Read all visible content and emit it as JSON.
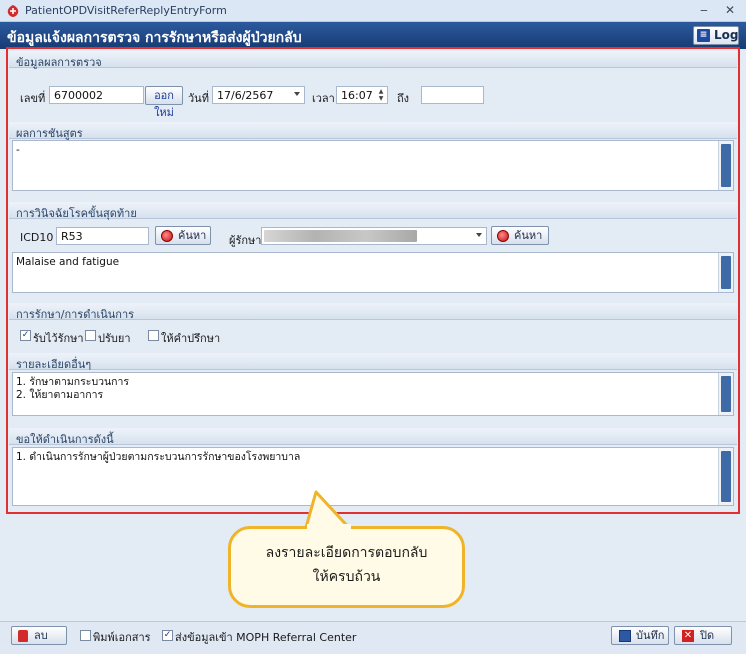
{
  "window": {
    "title": "PatientOPDVisitReferReplyEntryForm",
    "minimize": "‒",
    "close": "✕"
  },
  "header": {
    "title": "ข้อมูลแจ้งผลการตรวจ การรักษาหรือส่งผู้ป่วยกลับ",
    "log_label": "Log"
  },
  "exam": {
    "section": "ข้อมูลผลการตรวจ",
    "number_label": "เลขที่",
    "number_value": "6700002",
    "new_button": "ออกใหม่",
    "date_label": "วันที่",
    "date_value": "17/6/2567",
    "time_label": "เวลา",
    "time_value": "16:07",
    "to_label": "ถึง",
    "to_value": ""
  },
  "lab": {
    "section": "ผลการชันสูตร",
    "lines": [
      "-"
    ]
  },
  "diagnosis": {
    "section": "การวินิจฉัยโรคขั้นสุดท้าย",
    "icd_label": "ICD10",
    "icd_value": "R53",
    "search_label": "ค้นหา",
    "doctor_label": "ผู้รักษา",
    "lines": [
      "Malaise and fatigue"
    ]
  },
  "treatment": {
    "section": "การรักษา/การดำเนินการ",
    "options": [
      {
        "label": "รับไว้รักษา",
        "checked": true
      },
      {
        "label": "ปรับยา",
        "checked": false
      },
      {
        "label": "ให้คำปรึกษา",
        "checked": false
      }
    ]
  },
  "details": {
    "section": "รายละเอียดอื่นๆ",
    "lines": [
      "1. รักษาตามกระบวนการ",
      "2. ให้ยาตามอาการ"
    ]
  },
  "request": {
    "section": "ขอให้ดำเนินการดังนี้",
    "lines": [
      "1. ดำเนินการรักษาผู้ป่วยตามกระบวนการรักษาของโรงพยาบาล"
    ]
  },
  "callout": {
    "line1": "ลงรายละเอียดการตอบกลับ",
    "line2": "ให้ครบถ้วน"
  },
  "footer": {
    "delete_label": "ลบ",
    "print_label": "พิมพ์เอกสาร",
    "print_checked": false,
    "send_label": "ส่งข้อมูลเข้า MOPH Referral Center",
    "send_checked": true,
    "save_label": "บันทึก",
    "close_label": "ปิด"
  },
  "colors": {
    "header_bg": "#1f4a8a",
    "frame_red": "#e03030",
    "callout_border": "#f0b429"
  }
}
